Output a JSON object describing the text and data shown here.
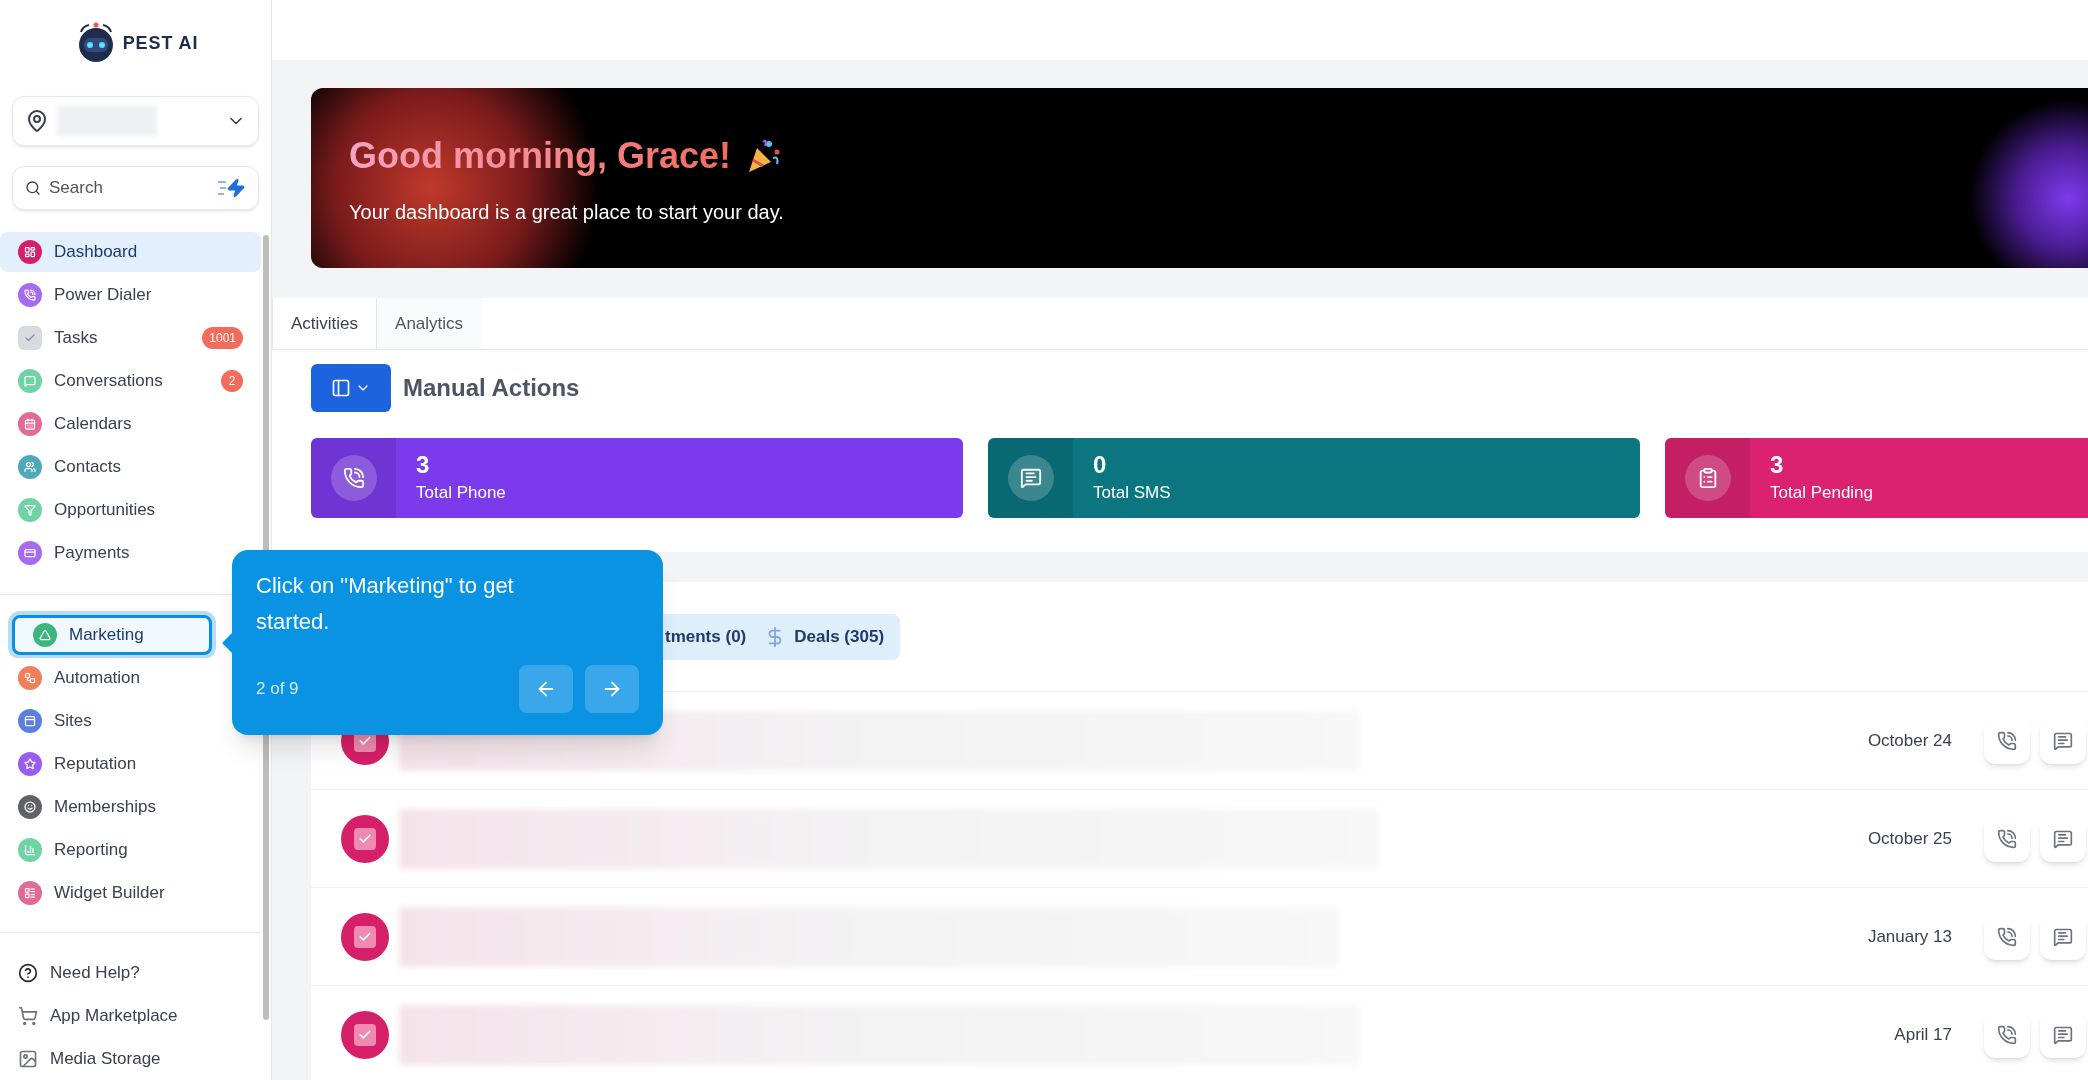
{
  "brand": {
    "name": "PEST AI"
  },
  "search": {
    "placeholder": "Search"
  },
  "nav_main": [
    {
      "label": "Dashboard",
      "color": "#d61f69",
      "selected": true,
      "tour_target": false
    },
    {
      "label": "Power Dialer",
      "color": "#a66bf0",
      "selected": false,
      "tour_target": false
    },
    {
      "label": "Tasks",
      "color": "#d9dbe0",
      "selected": false,
      "tour_target": false,
      "badge": "1001"
    },
    {
      "label": "Conversations",
      "color": "#6fd3a6",
      "selected": false,
      "tour_target": false,
      "badge": "2"
    },
    {
      "label": "Calendars",
      "color": "#e26a93",
      "selected": false,
      "tour_target": false
    },
    {
      "label": "Contacts",
      "color": "#4fa9b8",
      "selected": false,
      "tour_target": false
    },
    {
      "label": "Opportunities",
      "color": "#6fd3a6",
      "selected": false,
      "tour_target": false
    },
    {
      "label": "Payments",
      "color": "#a66bf0",
      "selected": false,
      "tour_target": false
    }
  ],
  "nav_tools": [
    {
      "label": "Marketing",
      "color": "#3bb77e",
      "selected": false,
      "tour_target": true
    },
    {
      "label": "Automation",
      "color": "#f07f5a",
      "selected": false,
      "tour_target": false
    },
    {
      "label": "Sites",
      "color": "#5b7fe0",
      "selected": false,
      "tour_target": false
    },
    {
      "label": "Reputation",
      "color": "#9b5cf0",
      "selected": false,
      "tour_target": false
    },
    {
      "label": "Memberships",
      "color": "#5f6368",
      "selected": false,
      "tour_target": false
    },
    {
      "label": "Reporting",
      "color": "#6fd3a6",
      "selected": false,
      "tour_target": false
    },
    {
      "label": "Widget Builder",
      "color": "#e26a93",
      "selected": false,
      "tour_target": false
    }
  ],
  "nav_bottom": [
    {
      "label": "Need Help?"
    },
    {
      "label": "App Marketplace"
    },
    {
      "label": "Media Storage"
    }
  ],
  "banner": {
    "greeting": "Good morning, Grace!",
    "subtitle": "Your dashboard is a great place to start your day."
  },
  "tabs": [
    {
      "label": "Activities",
      "selected": true
    },
    {
      "label": "Analytics",
      "selected": false
    }
  ],
  "section_title": "Manual Actions",
  "stats": [
    {
      "value": "3",
      "label": "Total Phone",
      "color": "#7c3aed"
    },
    {
      "value": "0",
      "label": "Total SMS",
      "color": "#0b7580"
    },
    {
      "value": "3",
      "label": "Total Pending",
      "color": "#db2270"
    }
  ],
  "filters": [
    {
      "label": "tments",
      "count": "(0)"
    },
    {
      "label": "Deals",
      "count": "(305)"
    }
  ],
  "tasks": [
    {
      "date": "October 24"
    },
    {
      "date": "October 25"
    },
    {
      "date": "January 13"
    },
    {
      "date": "April 17"
    }
  ],
  "tour": {
    "text": "Click on \"Marketing\" to get started.",
    "step": "2 of 9"
  }
}
